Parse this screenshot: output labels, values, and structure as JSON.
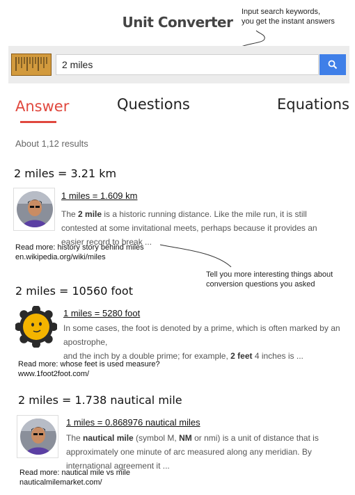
{
  "app": {
    "title": "Unit Converter"
  },
  "annotations": {
    "search_hint_line1": "Input search keywords,",
    "search_hint_line2": "you get the instant answers",
    "more_info_line1": "Tell you more interesting things about",
    "more_info_line2": "conversion questions you asked"
  },
  "search": {
    "value": "2 miles",
    "logo_icon": "ruler-icon",
    "button_icon": "search-icon",
    "button_color": "#3f7fe8"
  },
  "tabs": [
    {
      "label": "Answer",
      "active": true
    },
    {
      "label": "Questions",
      "active": false
    },
    {
      "label": "Equations",
      "active": false
    }
  ],
  "accent_color": "#e0483e",
  "results_count": "About 1,12  results",
  "answers": [
    {
      "heading": "2 miles = 3.21 km",
      "link": "1 miles = 1.609 km",
      "snippet": {
        "pre": "The ",
        "bold": "2 mile",
        "post": " is a historic running distance. Like the mile run, it is still contested at some invitational meets, perhaps because it provides an easier record to break ..."
      },
      "readmore": "Read more: history story behind miles",
      "url": "en.wikipedia.org/wiki/miles"
    },
    {
      "heading": "2 miles = 10560 foot",
      "link": "1 miles = 5280 foot",
      "snippet": {
        "line1": "In some cases, the foot is denoted by a prime, which is often marked by an apostrophe,",
        "pre": "and the inch by a double prime; for example, ",
        "bold": "2 feet",
        "post": " 4 inches is ..."
      },
      "readmore": "Read more: whose feet is used measure?",
      "url": "www.1foot2foot.com/"
    },
    {
      "heading": "2 miles = 1.738 nautical mile",
      "link": "1 miles = 0.868976 nautical miles",
      "snippet": {
        "pre": "The ",
        "bold": "nautical mile",
        "mid": " (symbol M, ",
        "bold2": "NM",
        "post": " or nmi) is a unit of distance that is approximately one minute of arc measured along any meridian. By international agreement it ..."
      },
      "readmore": "Read more: nautical mile vs mile",
      "url": "nauticalmilemarket.com/"
    }
  ]
}
